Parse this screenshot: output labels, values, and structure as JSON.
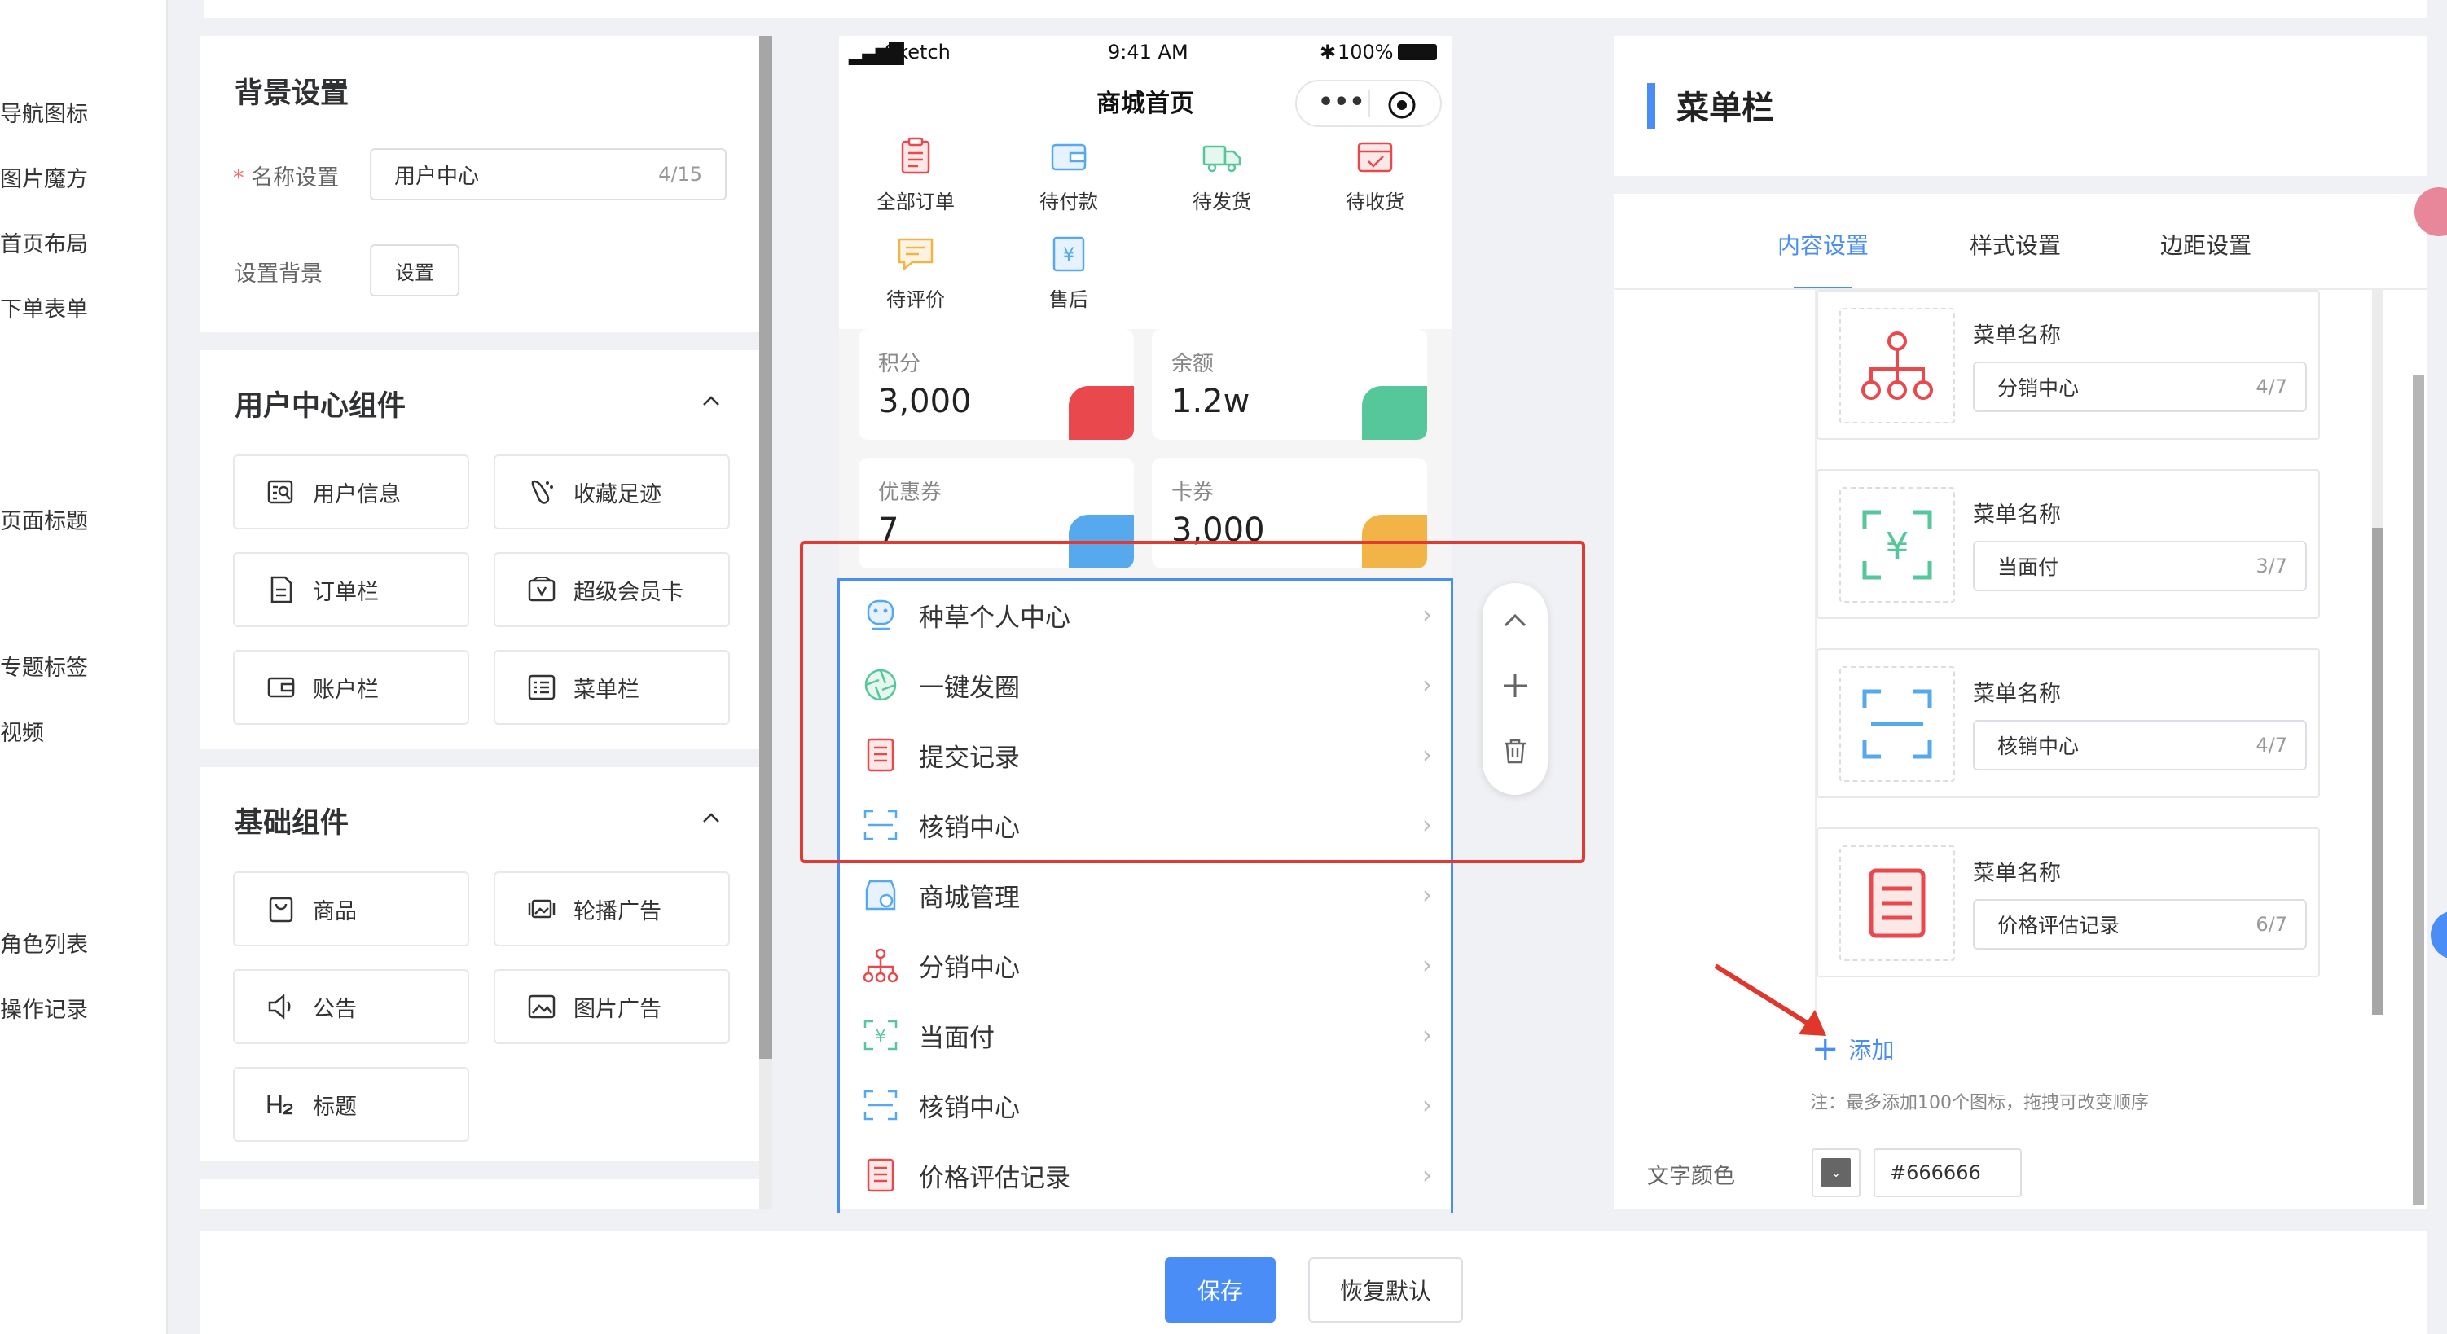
{
  "left_nav": [
    "导航图标",
    "图片魔方",
    "首页布局",
    "下单表单",
    "页面标题",
    "专题标签",
    "视频",
    "角色列表",
    "操作记录"
  ],
  "bg_settings": {
    "title": "背景设置",
    "required_mark": "*",
    "name_label": "名称设置",
    "name_value": "用户中心",
    "name_counter": "4/15",
    "bg_label": "设置背景",
    "bg_button": "设置"
  },
  "user_components": {
    "title": "用户中心组件",
    "items": [
      "用户信息",
      "收藏足迹",
      "订单栏",
      "超级会员卡",
      "账户栏",
      "菜单栏"
    ]
  },
  "basic_components": {
    "title": "基础组件",
    "items": [
      "商品",
      "轮播广告",
      "公告",
      "图片广告",
      "标题"
    ]
  },
  "phone": {
    "carrier": "Sketch",
    "time": "9:41 AM",
    "battery": "100%",
    "page_title": "商城首页",
    "orders": [
      "全部订单",
      "待付款",
      "待发货",
      "待收货",
      "待评价",
      "售后"
    ],
    "cards": [
      {
        "label": "积分",
        "value": "3,000",
        "color": "#e9484c"
      },
      {
        "label": "余额",
        "value": "1.2w",
        "color": "#55c79a"
      },
      {
        "label": "优惠券",
        "value": "7",
        "color": "#57a9ee"
      },
      {
        "label": "卡券",
        "value": "3,000",
        "color": "#f2b447"
      }
    ],
    "menu": [
      "种草个人中心",
      "一键发圈",
      "提交记录",
      "核销中心",
      "商城管理",
      "分销中心",
      "当面付",
      "核销中心",
      "价格评估记录"
    ]
  },
  "right_panel": {
    "title": "菜单栏",
    "tabs": [
      "内容设置",
      "样式设置",
      "边距设置"
    ],
    "active_tab": "内容设置",
    "items": [
      {
        "label": "菜单名称",
        "value": "分销中心",
        "counter": "4/7"
      },
      {
        "label": "菜单名称",
        "value": "当面付",
        "counter": "3/7"
      },
      {
        "label": "菜单名称",
        "value": "核销中心",
        "counter": "4/7"
      },
      {
        "label": "菜单名称",
        "value": "价格评估记录",
        "counter": "6/7"
      }
    ],
    "add_label": "添加",
    "note": "注：最多添加100个图标，拖拽可改变顺序",
    "text_color_label": "文字颜色",
    "text_color_value": "#666666"
  },
  "footer": {
    "save": "保存",
    "reset": "恢复默认"
  },
  "colors": {
    "accent": "#4a8df6",
    "highlight": "#e23a32",
    "arrow": "#e0362c"
  }
}
